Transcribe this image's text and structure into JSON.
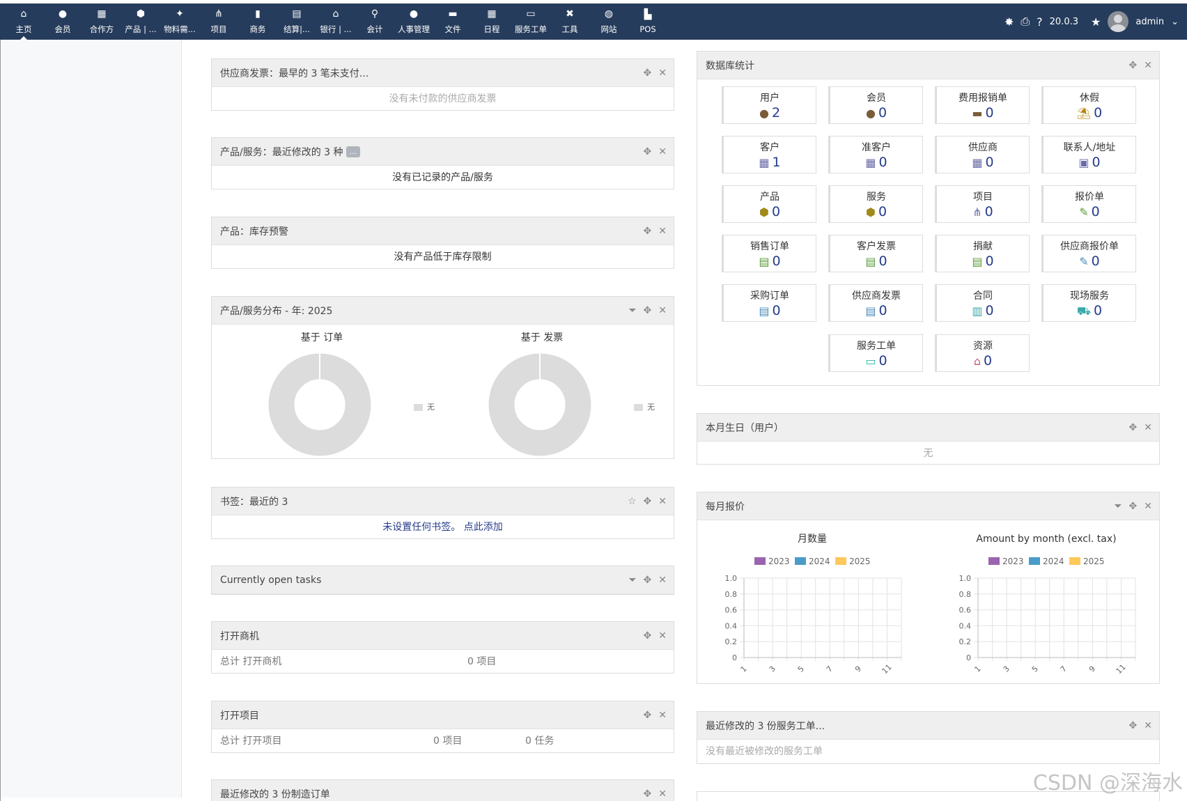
{
  "nav": {
    "items": [
      {
        "label": "主页",
        "icon": "⌂"
      },
      {
        "label": "会员",
        "icon": "●"
      },
      {
        "label": "合作方",
        "icon": "▦"
      },
      {
        "label": "产品 | ...",
        "icon": "⬢"
      },
      {
        "label": "物料需...",
        "icon": "✦"
      },
      {
        "label": "项目",
        "icon": "⋔"
      },
      {
        "label": "商务",
        "icon": "▮"
      },
      {
        "label": "结算|...",
        "icon": "▤"
      },
      {
        "label": "银行 | ...",
        "icon": "⌂"
      },
      {
        "label": "会计",
        "icon": "⚲"
      },
      {
        "label": "人事管理",
        "icon": "●"
      },
      {
        "label": "文件",
        "icon": "▬"
      },
      {
        "label": "日程",
        "icon": "▦"
      },
      {
        "label": "服务工单",
        "icon": "▭"
      },
      {
        "label": "工具",
        "icon": "✖"
      },
      {
        "label": "网站",
        "icon": "◍"
      },
      {
        "label": "POS",
        "icon": "▙"
      }
    ],
    "version": "20.0.3",
    "user": "admin"
  },
  "left": {
    "supplier_invoices": {
      "title": "供应商发票：最早的 3 笔未支付...",
      "body": "没有未付款的供应商发票"
    },
    "products_recent": {
      "title": "产品/服务：最近修改的 3 种",
      "tag": "...",
      "body": "没有已记录的产品/服务"
    },
    "stock_alert": {
      "title": "产品：库存预警",
      "body": "没有产品低于库存限制"
    },
    "distribution": {
      "title": "产品/服务分布 - 年: 2025",
      "chart1_title": "基于 订单",
      "chart2_title": "基于 发票",
      "legend_label": "无"
    },
    "bookmarks": {
      "title": "书签：最近的 3",
      "body": "未设置任何书签。 点此添加"
    },
    "open_tasks": {
      "title": "Currently open tasks"
    },
    "open_opps": {
      "title": "打开商机",
      "label": "总计 打开商机",
      "value": "0 项目"
    },
    "open_projects": {
      "title": "打开项目",
      "label": "总计 打开项目",
      "value": "0 项目",
      "tasks": "0 任务"
    },
    "mo_recent": {
      "title": "最近修改的 3 份制造订单"
    }
  },
  "right": {
    "db_stats": {
      "title": "数据库统计",
      "items": [
        {
          "label": "用户",
          "value": "2",
          "icon": "●",
          "color": "#7a5c3a"
        },
        {
          "label": "会员",
          "value": "0",
          "icon": "●",
          "color": "#7a5c3a"
        },
        {
          "label": "费用报销单",
          "value": "0",
          "icon": "▬",
          "color": "#7a5c3a"
        },
        {
          "label": "休假",
          "value": "0",
          "icon": "⛱",
          "color": "#b8860b"
        },
        {
          "label": "客户",
          "value": "1",
          "icon": "▦",
          "color": "#6a6aa8"
        },
        {
          "label": "准客户",
          "value": "0",
          "icon": "▦",
          "color": "#6a6aa8"
        },
        {
          "label": "供应商",
          "value": "0",
          "icon": "▦",
          "color": "#6a6aa8"
        },
        {
          "label": "联系人/地址",
          "value": "0",
          "icon": "▣",
          "color": "#6a6aa8"
        },
        {
          "label": "产品",
          "value": "0",
          "icon": "⬢",
          "color": "#a08a1a"
        },
        {
          "label": "服务",
          "value": "0",
          "icon": "⬢",
          "color": "#a08a1a"
        },
        {
          "label": "项目",
          "value": "0",
          "icon": "⋔",
          "color": "#6a6aa8"
        },
        {
          "label": "报价单",
          "value": "0",
          "icon": "✎",
          "color": "#5a9a3a"
        },
        {
          "label": "销售订单",
          "value": "0",
          "icon": "▤",
          "color": "#5a9a3a"
        },
        {
          "label": "客户发票",
          "value": "0",
          "icon": "▤",
          "color": "#5a9a3a"
        },
        {
          "label": "捐献",
          "value": "0",
          "icon": "▤",
          "color": "#5a9a3a"
        },
        {
          "label": "供应商报价单",
          "value": "0",
          "icon": "✎",
          "color": "#4a8ab8"
        },
        {
          "label": "采购订单",
          "value": "0",
          "icon": "▤",
          "color": "#4a8ab8"
        },
        {
          "label": "供应商发票",
          "value": "0",
          "icon": "▤",
          "color": "#4a8ab8"
        },
        {
          "label": "合同",
          "value": "0",
          "icon": "▥",
          "color": "#3aa8a8"
        },
        {
          "label": "现场服务",
          "value": "0",
          "icon": "⛟",
          "color": "#3aa8a8"
        },
        {
          "label": "服务工单",
          "value": "0",
          "icon": "▭",
          "color": "#2ab8a8"
        },
        {
          "label": "资源",
          "value": "0",
          "icon": "⌂",
          "color": "#c05a7a"
        }
      ]
    },
    "birthdays": {
      "title": "本月生日（用户）",
      "body": "无"
    },
    "monthly_quotes": {
      "title": "每月报价"
    },
    "tickets_recent": {
      "title": "最近修改的 3 份服务工单...",
      "body": "没有最近被修改的服务工单"
    }
  },
  "chart_data": [
    {
      "type": "line",
      "title": "月数量",
      "series": [
        {
          "name": "2023",
          "values": []
        },
        {
          "name": "2024",
          "values": []
        },
        {
          "name": "2025",
          "values": []
        }
      ],
      "colors": [
        "#9b64b0",
        "#4a9cc8",
        "#ffc85a"
      ],
      "xticks": [
        "1",
        "3",
        "5",
        "7",
        "9",
        "11"
      ],
      "yticks": [
        "1.0",
        "0.8",
        "0.6",
        "0.4",
        "0.2",
        "0"
      ],
      "ylim": [
        0,
        1
      ]
    },
    {
      "type": "line",
      "title": "Amount by month (excl. tax)",
      "series": [
        {
          "name": "2023",
          "values": []
        },
        {
          "name": "2024",
          "values": []
        },
        {
          "name": "2025",
          "values": []
        }
      ],
      "colors": [
        "#9b64b0",
        "#4a9cc8",
        "#ffc85a"
      ],
      "xticks": [
        "1",
        "3",
        "5",
        "7",
        "9",
        "11"
      ],
      "yticks": [
        "1.0",
        "0.8",
        "0.6",
        "0.4",
        "0.2",
        "0"
      ],
      "ylim": [
        0,
        1
      ]
    }
  ],
  "watermark": "CSDN @深海水"
}
